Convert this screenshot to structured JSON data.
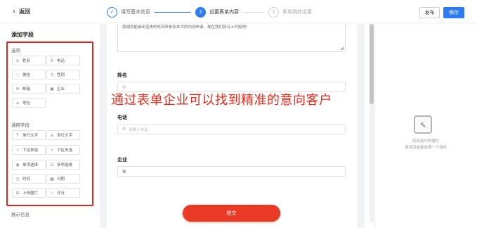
{
  "header": {
    "back_label": "返回",
    "steps": [
      {
        "index": "✓",
        "label": "填写基本信息",
        "state": "done"
      },
      {
        "index": "2",
        "label": "设置表单内容",
        "state": "active"
      },
      {
        "index": "3",
        "label": "表单跳转设置",
        "state": "todo"
      }
    ],
    "publish_label": "发布",
    "save_label": "保存"
  },
  "sidebar": {
    "title": "添加字段",
    "group1_title": "选项",
    "group1_items": [
      {
        "icon": "user-icon",
        "label": "姓名"
      },
      {
        "icon": "phone-icon",
        "label": "电话"
      },
      {
        "icon": "wechat-icon",
        "label": "微信"
      },
      {
        "icon": "gender-icon",
        "label": "性别"
      },
      {
        "icon": "mail-icon",
        "label": "邮箱"
      },
      {
        "icon": "company-icon",
        "label": "企业"
      },
      {
        "icon": "address-icon",
        "label": "地址"
      }
    ],
    "group2_title": "通用字段",
    "group2_items": [
      {
        "icon": "single-line-text-icon",
        "label": "单行文字"
      },
      {
        "icon": "multi-line-text-icon",
        "label": "多行文字"
      },
      {
        "icon": "dropdown-single-icon",
        "label": "下拉单选"
      },
      {
        "icon": "dropdown-multi-icon",
        "label": "下拉多选"
      },
      {
        "icon": "radio-icon",
        "label": "单项选择"
      },
      {
        "icon": "checkbox-icon",
        "label": "多项选择"
      },
      {
        "icon": "time-icon",
        "label": "时间"
      },
      {
        "icon": "date-icon",
        "label": "日期"
      },
      {
        "icon": "upload-image-icon",
        "label": "上传图片"
      },
      {
        "icon": "rating-icon",
        "label": "评分"
      }
    ],
    "group3_title": "展示信息"
  },
  "form": {
    "textarea_text": "感谢您能抽出宝贵的时间来参加本次的内测申请，现在我们就马上开始吧！",
    "name_label": "姓名",
    "phone_label": "电话",
    "phone_placeholder": "请输入电话",
    "company_label": "企业",
    "submit_label": "提交"
  },
  "overlay_caption": "通过表单企业可以找到精准的意向客户",
  "right_panel": {
    "empty_line1": "没有选中的组件",
    "empty_line2": "请添加或者选择一个组件"
  },
  "colors": {
    "accent": "#2f7bf5",
    "submit": "#e83a24",
    "highlight_border": "#d9281b",
    "overlay_text": "#ec2b1c"
  }
}
